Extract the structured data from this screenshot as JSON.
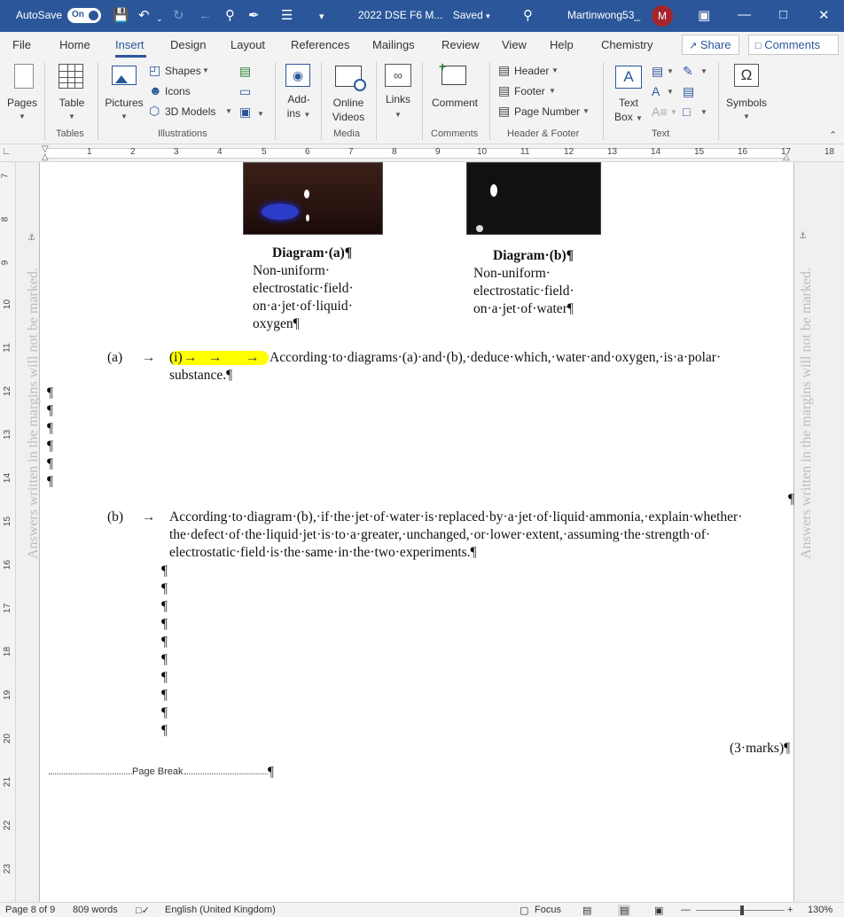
{
  "titlebar": {
    "autosave_label": "AutoSave",
    "autosave_state": "On",
    "document_title": "2022 DSE F6 M...",
    "save_status": "Saved",
    "user_name": "Martinwong53_",
    "avatar_initial": "M"
  },
  "tabs": [
    {
      "label": "File"
    },
    {
      "label": "Home"
    },
    {
      "label": "Insert",
      "active": true
    },
    {
      "label": "Design"
    },
    {
      "label": "Layout"
    },
    {
      "label": "References"
    },
    {
      "label": "Mailings"
    },
    {
      "label": "Review"
    },
    {
      "label": "View"
    },
    {
      "label": "Help"
    },
    {
      "label": "Chemistry"
    }
  ],
  "share_label": "Share",
  "comments_label": "Comments",
  "ribbon": {
    "pages": "Pages",
    "table": "Table",
    "pictures": "Pictures",
    "shapes": "Shapes",
    "icons": "Icons",
    "models3d": "3D Models",
    "addins_line1": "Add-",
    "addins_line2": "ins",
    "online_line1": "Online",
    "online_line2": "Videos",
    "links": "Links",
    "comment": "Comment",
    "header": "Header",
    "footer": "Footer",
    "page_number": "Page Number",
    "textbox_line1": "Text",
    "textbox_line2": "Box",
    "symbols": "Symbols",
    "groups": {
      "tables": "Tables",
      "illustrations": "Illustrations",
      "media": "Media",
      "comments": "Comments",
      "header_footer": "Header & Footer",
      "text": "Text"
    }
  },
  "ruler_numbers": [
    "1",
    "2",
    "3",
    "4",
    "5",
    "6",
    "7",
    "8",
    "9",
    "10",
    "11",
    "12",
    "13",
    "14",
    "15",
    "16",
    "17",
    "18"
  ],
  "vruler_numbers": [
    "7",
    "8",
    "9",
    "10",
    "11",
    "12",
    "13",
    "14",
    "15",
    "16",
    "17",
    "18",
    "19",
    "20",
    "21",
    "22",
    "23"
  ],
  "document": {
    "margin_note": "Answers written in the margins will not be marked.",
    "diagram_a_title": "Diagram·(a)¶",
    "diagram_a_lines": [
      "Non-uniform·",
      "electrostatic·field·",
      "on·a·jet·of·liquid·",
      "oxygen¶"
    ],
    "diagram_b_title": "Diagram·(b)¶",
    "diagram_b_lines": [
      "Non-uniform·",
      "electrostatic·field·",
      "on·a·jet·of·water¶"
    ],
    "q_a_label": "(a)",
    "q_a_sub": "(i)",
    "q_a_text_line1": "According·to·diagrams·(a)·and·(b),·deduce·which,·water·and·oxygen,·is·a·polar·",
    "q_a_text_line2": "substance.¶",
    "q_b_label": "(b)",
    "q_b_line1": "According·to·diagram·(b),·if·the·jet·of·water·is·replaced·by·a·jet·of·liquid·ammonia,·explain·whether·",
    "q_b_line2": "the·defect·of·the·liquid·jet·is·to·a·greater,·unchanged,·or·lower·extent,·assuming·the·strength·of·",
    "q_b_line3": "electrostatic·field·is·the·same·in·the·two·experiments.¶",
    "marks": "(3·marks)¶",
    "page_break": "Page Break",
    "pilcrow": "¶",
    "arrow": "→"
  },
  "statusbar": {
    "page": "Page 8 of 9",
    "words": "809 words",
    "language": "English (United Kingdom)",
    "focus": "Focus",
    "zoom": "130%"
  }
}
